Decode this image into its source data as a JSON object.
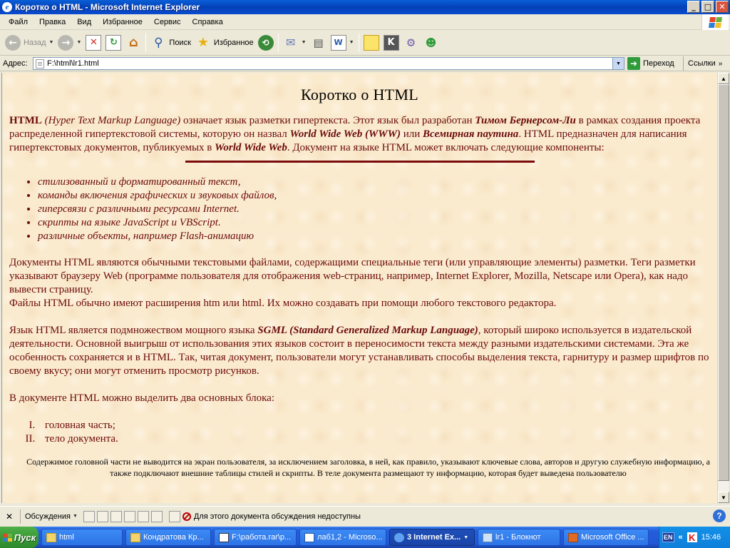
{
  "window": {
    "title": "Коротко о HTML - Microsoft Internet Explorer",
    "minimize": "_",
    "maximize": "□",
    "close": "✕"
  },
  "menu": [
    "Файл",
    "Правка",
    "Вид",
    "Избранное",
    "Сервис",
    "Справка"
  ],
  "toolbar": {
    "back_label": "Назад",
    "search_label": "Поиск",
    "favorites_label": "Избранное"
  },
  "address": {
    "label": "Адрес:",
    "url": "F:\\html\\lr1.html",
    "go_label": "Переход",
    "links_label": "Ссылки"
  },
  "page": {
    "heading": "Коротко о HTML",
    "intro": {
      "html": "HTML",
      "expansion": "(Hyper Text Markup Language)",
      "t1": " означает язык разметки гипертекста. Этот язык был разработан ",
      "author": "Тимом Бернерсом-Ли",
      "t2": " в рамках создания проекта распределенной гипертекстовой системы, которую он назвал ",
      "www": "World Wide Web (WWW)",
      "t3": " или ",
      "web": "Всемирная паутина",
      "t4": ". HTML предназначен для написания гипертекстовых документов, публикуемых в ",
      "www2": "World Wide Web",
      "t5": ". Документ на языке HTML может включать следующие компоненты:"
    },
    "bullets": [
      "стилизованный и форматированный текст,",
      "команды включения графических и звуковых файлов,",
      "гиперсвязи с различными ресурсами Internet.",
      "скрипты на языке JavaScript и VBScript.",
      "различные объекты, например Flash-анимацию"
    ],
    "para2": "Документы HTML являются обычными текстовыми файлами, содержащими специальные теги (или управляющие элементы) разметки. Теги разметки указывают браузеру Web (программе пользователя для отображения web-страниц, например, Internet Explorer, Mozilla, Netscape или Opera), как надо вывести страницу.",
    "para3": "Файлы HTML обычно имеют расширения htm или html. Их можно создавать при помощи любого текстового редактора.",
    "para4": {
      "t1": "Язык HTML является подмножеством мощного языка ",
      "sgml": "SGML (Standard Generalized Markup Language)",
      "t2": ", который широко используется в издательской деятельности. Основной выигрыш от использования этих языков состоит в переносимости текста между разными издательскими системами. Эта же особенность сохраняется и в HTML. Так, читая документ, пользователи могут устанавливать способы выделения текста, гарнитуру и размер шрифтов по своему вкусу; они могут отменить просмотр рисунков."
    },
    "para5": "В документе HTML можно выделить два основных блока:",
    "blocks": [
      "головная часть;",
      "тело документа."
    ],
    "note": "Содержимое головной части не выводится на экран пользователя, за исключением заголовка, в ней, как правило, указывают ключевые слова, авторов и другую служебную информацию, а также подключают внешние таблицы стилей и скрипты. В теле документа размещают ту информацию, которая будет выведена пользователю"
  },
  "discussion": {
    "menu_label": "Обсуждения",
    "status": "Для этого документа обсуждения недоступны"
  },
  "taskbar": {
    "start_label": "Пуск",
    "items": [
      "html",
      "Кондратова Кр...",
      "F:\\работа.rar\\р...",
      "лаб1,2 - Microso...",
      "3 Internet Ex...",
      "lr1 - Блокнот",
      "Microsoft Office ..."
    ],
    "lang": "EN",
    "clock": "15:46"
  },
  "colors": {
    "content_bg": "#fbebce",
    "text": "#6b0a0a",
    "rule": "#7a0b0b",
    "titlebar": "#0a5fd8",
    "taskbar": "#245edb",
    "start": "#3a9a36"
  }
}
